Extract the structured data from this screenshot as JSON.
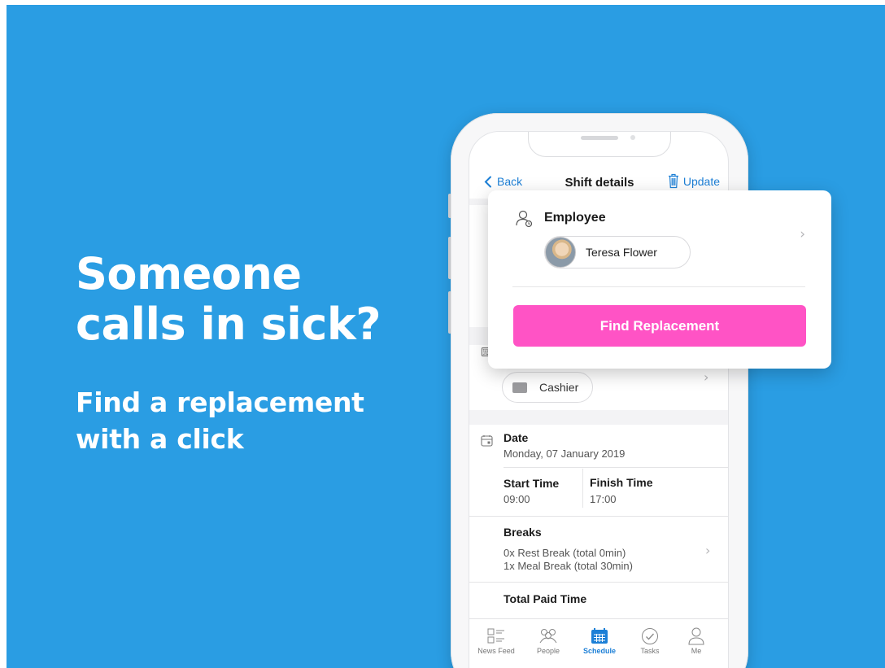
{
  "promo": {
    "headline_line1": "Someone",
    "headline_line2": "calls in sick?",
    "subline_line1": "Find a replacement",
    "subline_line2": "with a click",
    "background_color": "#2a9de3"
  },
  "nav": {
    "back_label": "Back",
    "title": "Shift details",
    "update_label": "Update"
  },
  "card": {
    "employee_label": "Employee",
    "employee_name": "Teresa Flower",
    "find_button_label": "Find Replacement",
    "button_color": "#ff53c5"
  },
  "role": {
    "name": "Cashier"
  },
  "date": {
    "label": "Date",
    "value": "Monday, 07 January 2019"
  },
  "time": {
    "start_label": "Start Time",
    "start_value": "09:00",
    "finish_label": "Finish Time",
    "finish_value": "17:00"
  },
  "breaks": {
    "label": "Breaks",
    "line1": "0x Rest Break (total 0min)",
    "line2": "1x Meal Break (total 30min)"
  },
  "paid": {
    "label": "Total Paid Time"
  },
  "tabs": [
    {
      "label": "News Feed",
      "icon": "news-feed-icon",
      "active": false
    },
    {
      "label": "People",
      "icon": "people-icon",
      "active": false
    },
    {
      "label": "Schedule",
      "icon": "calendar-icon",
      "active": true
    },
    {
      "label": "Tasks",
      "icon": "check-circle-icon",
      "active": false
    },
    {
      "label": "Me",
      "icon": "user-icon",
      "active": false
    }
  ],
  "accent_color": "#1c7fd6"
}
